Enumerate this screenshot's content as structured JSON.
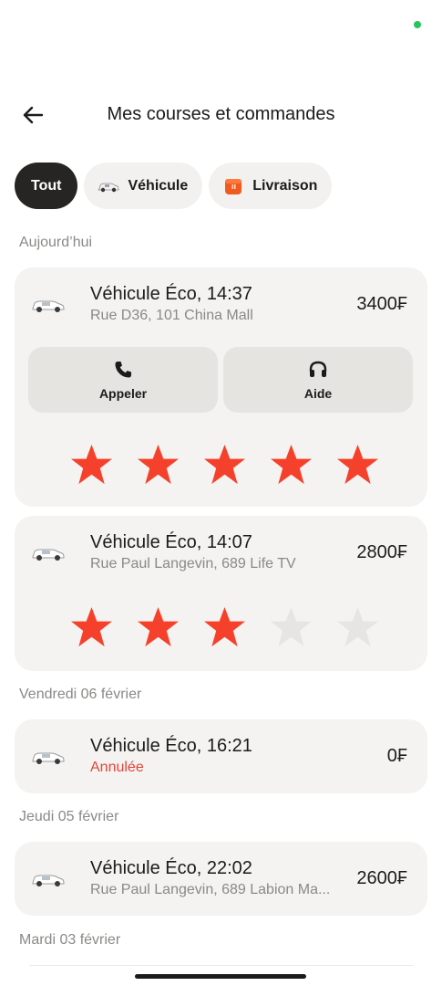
{
  "header": {
    "title": "Mes courses et commandes"
  },
  "filters": [
    {
      "label": "Tout",
      "active": true
    },
    {
      "label": "Véhicule",
      "icon": "car-icon"
    },
    {
      "label": "Livraison",
      "icon": "delivery-box-icon"
    }
  ],
  "sections": {
    "today": "Aujourd’hui",
    "friday": "Vendredi 06 février",
    "thursday": "Jeudi 05 février",
    "tuesday": "Mardi 03 février"
  },
  "rides": [
    {
      "title": "Véhicule Éco, 14:37",
      "subtitle": "Rue D36, 101 China Mall",
      "price": "3400₣",
      "rating": 5
    },
    {
      "title": "Véhicule Éco, 14:07",
      "subtitle": "Rue Paul Langevin, 689 Life TV",
      "price": "2800₣",
      "rating": 3
    },
    {
      "title": "Véhicule Éco, 16:21",
      "subtitle": "Annulée",
      "price": "0₣",
      "status": "cancelled"
    },
    {
      "title": "Véhicule Éco, 22:02",
      "subtitle": "Rue Paul Langevin, 689 Labion Ma...",
      "price": "2600₣"
    }
  ],
  "actions": {
    "call_label": "Appeler",
    "help_label": "Aide"
  },
  "colors": {
    "star_filled": "#f5412b",
    "star_empty": "#e6e5e3",
    "accent_green": "#22c55e",
    "cancelled": "#e5433a"
  },
  "max_rating": 5
}
